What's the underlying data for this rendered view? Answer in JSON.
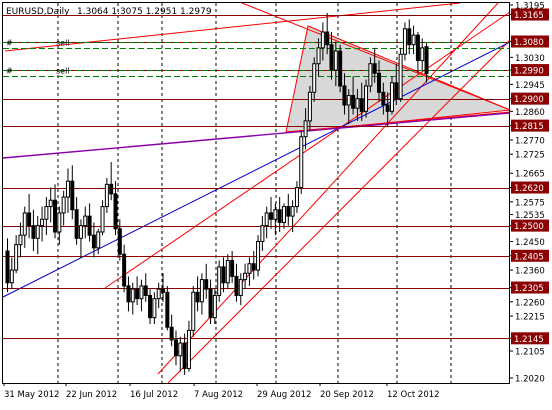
{
  "header": {
    "symbol": "EURUSD,Daily",
    "ohlc": "1.3064 1.3075 1.2951 1.2979"
  },
  "orders": [
    {
      "label": "sell",
      "price": 1.308
    },
    {
      "label": "sell",
      "price": 1.299
    }
  ],
  "colors": {
    "background": "#ffffff",
    "frame": "#000000",
    "candle": "#000000",
    "level_line": "#8b0000",
    "badge": "#8b0000",
    "badge_text": "#ffffff",
    "order_line": "#008000",
    "channel": "#ff0000",
    "trend_blue": "#0000cc",
    "trend_purple": "#8b00a8",
    "triangle_fill": "#d8d8d8",
    "grid": "#000000"
  },
  "chart_data": {
    "type": "candlestick",
    "symbol": "EURUSD",
    "timeframe": "Daily",
    "y_axis": {
      "min": 1.202,
      "max": 1.3195,
      "tick_labels": [
        "1.3195",
        "1.3165",
        "1.3080",
        "1.3030",
        "1.2990",
        "1.2945",
        "1.2900",
        "1.2860",
        "1.2815",
        "1.2770",
        "1.2725",
        "1.2665",
        "1.2620",
        "1.2575",
        "1.2535",
        "1.2500",
        "1.2450",
        "1.2405",
        "1.2360",
        "1.2305",
        "1.2260",
        "1.2215",
        "1.2145",
        "1.2105",
        "1.2020"
      ]
    },
    "x_axis": {
      "tick_labels": [
        "31 May 2012",
        "22 Jun 2012",
        "16 Jul 2012",
        "7 Aug 2012",
        "29 Aug 2012",
        "20 Sep 2012",
        "12 Oct 2012"
      ]
    },
    "levels": [
      1.3165,
      1.308,
      1.299,
      1.29,
      1.2815,
      1.262,
      1.25,
      1.2405,
      1.2305,
      1.2145
    ],
    "grid": "vertical dashed",
    "candles": [
      [
        1.242,
        1.246,
        1.229,
        1.232
      ],
      [
        1.232,
        1.24,
        1.23,
        1.236
      ],
      [
        1.236,
        1.247,
        1.235,
        1.244
      ],
      [
        1.244,
        1.251,
        1.24,
        1.247
      ],
      [
        1.247,
        1.256,
        1.243,
        1.254
      ],
      [
        1.254,
        1.26,
        1.246,
        1.25
      ],
      [
        1.25,
        1.255,
        1.242,
        1.246
      ],
      [
        1.246,
        1.253,
        1.241,
        1.25
      ],
      [
        1.25,
        1.256,
        1.245,
        1.252
      ],
      [
        1.252,
        1.259,
        1.247,
        1.256
      ],
      [
        1.256,
        1.262,
        1.251,
        1.258
      ],
      [
        1.258,
        1.263,
        1.246,
        1.248
      ],
      [
        1.248,
        1.256,
        1.244,
        1.254
      ],
      [
        1.254,
        1.261,
        1.25,
        1.259
      ],
      [
        1.259,
        1.268,
        1.254,
        1.264
      ],
      [
        1.264,
        1.269,
        1.252,
        1.255
      ],
      [
        1.255,
        1.259,
        1.244,
        1.246
      ],
      [
        1.246,
        1.252,
        1.24,
        1.25
      ],
      [
        1.25,
        1.256,
        1.246,
        1.253
      ],
      [
        1.253,
        1.257,
        1.245,
        1.247
      ],
      [
        1.247,
        1.251,
        1.24,
        1.243
      ],
      [
        1.243,
        1.249,
        1.241,
        1.248
      ],
      [
        1.248,
        1.258,
        1.247,
        1.256
      ],
      [
        1.256,
        1.265,
        1.254,
        1.263
      ],
      [
        1.263,
        1.27,
        1.258,
        1.26
      ],
      [
        1.26,
        1.264,
        1.247,
        1.249
      ],
      [
        1.249,
        1.252,
        1.239,
        1.241
      ],
      [
        1.241,
        1.244,
        1.229,
        1.231
      ],
      [
        1.231,
        1.234,
        1.223,
        1.226
      ],
      [
        1.226,
        1.232,
        1.222,
        1.23
      ],
      [
        1.23,
        1.234,
        1.225,
        1.227
      ],
      [
        1.227,
        1.233,
        1.223,
        1.231
      ],
      [
        1.231,
        1.235,
        1.226,
        1.228
      ],
      [
        1.228,
        1.23,
        1.219,
        1.221
      ],
      [
        1.221,
        1.229,
        1.219,
        1.227
      ],
      [
        1.227,
        1.232,
        1.224,
        1.23
      ],
      [
        1.23,
        1.235,
        1.226,
        1.229
      ],
      [
        1.229,
        1.231,
        1.217,
        1.218
      ],
      [
        1.218,
        1.222,
        1.212,
        1.214
      ],
      [
        1.214,
        1.217,
        1.206,
        1.209
      ],
      [
        1.209,
        1.215,
        1.204,
        1.213
      ],
      [
        1.213,
        1.216,
        1.203,
        1.205
      ],
      [
        1.205,
        1.22,
        1.204,
        1.217
      ],
      [
        1.217,
        1.231,
        1.215,
        1.229
      ],
      [
        1.229,
        1.234,
        1.223,
        1.226
      ],
      [
        1.226,
        1.235,
        1.222,
        1.233
      ],
      [
        1.233,
        1.238,
        1.227,
        1.23
      ],
      [
        1.23,
        1.233,
        1.219,
        1.221
      ],
      [
        1.221,
        1.23,
        1.219,
        1.228
      ],
      [
        1.228,
        1.239,
        1.226,
        1.237
      ],
      [
        1.237,
        1.24,
        1.229,
        1.232
      ],
      [
        1.232,
        1.241,
        1.23,
        1.239
      ],
      [
        1.239,
        1.242,
        1.232,
        1.234
      ],
      [
        1.234,
        1.238,
        1.226,
        1.228
      ],
      [
        1.228,
        1.235,
        1.225,
        1.233
      ],
      [
        1.233,
        1.238,
        1.23,
        1.235
      ],
      [
        1.235,
        1.24,
        1.231,
        1.238
      ],
      [
        1.238,
        1.242,
        1.233,
        1.236
      ],
      [
        1.236,
        1.247,
        1.234,
        1.245
      ],
      [
        1.245,
        1.253,
        1.242,
        1.25
      ],
      [
        1.25,
        1.256,
        1.246,
        1.254
      ],
      [
        1.254,
        1.259,
        1.249,
        1.252
      ],
      [
        1.252,
        1.257,
        1.247,
        1.255
      ],
      [
        1.255,
        1.259,
        1.248,
        1.251
      ],
      [
        1.251,
        1.257,
        1.249,
        1.256
      ],
      [
        1.256,
        1.26,
        1.25,
        1.253
      ],
      [
        1.253,
        1.258,
        1.248,
        1.256
      ],
      [
        1.256,
        1.264,
        1.254,
        1.262
      ],
      [
        1.262,
        1.28,
        1.26,
        1.278
      ],
      [
        1.278,
        1.287,
        1.274,
        1.283
      ],
      [
        1.283,
        1.294,
        1.28,
        1.292
      ],
      [
        1.292,
        1.303,
        1.289,
        1.301
      ],
      [
        1.301,
        1.309,
        1.297,
        1.306
      ],
      [
        1.306,
        1.314,
        1.302,
        1.311
      ],
      [
        1.311,
        1.317,
        1.304,
        1.307
      ],
      [
        1.307,
        1.311,
        1.296,
        1.299
      ],
      [
        1.299,
        1.308,
        1.294,
        1.305
      ],
      [
        1.305,
        1.307,
        1.292,
        1.294
      ],
      [
        1.294,
        1.298,
        1.285,
        1.288
      ],
      [
        1.288,
        1.293,
        1.282,
        1.291
      ],
      [
        1.291,
        1.297,
        1.285,
        1.287
      ],
      [
        1.287,
        1.293,
        1.283,
        1.29
      ],
      [
        1.29,
        1.295,
        1.283,
        1.286
      ],
      [
        1.286,
        1.296,
        1.284,
        1.294
      ],
      [
        1.294,
        1.303,
        1.292,
        1.301
      ],
      [
        1.301,
        1.306,
        1.295,
        1.298
      ],
      [
        1.298,
        1.302,
        1.289,
        1.292
      ],
      [
        1.292,
        1.295,
        1.285,
        1.288
      ],
      [
        1.288,
        1.292,
        1.281,
        1.286
      ],
      [
        1.286,
        1.297,
        1.285,
        1.295
      ],
      [
        1.295,
        1.301,
        1.288,
        1.29
      ],
      [
        1.29,
        1.306,
        1.289,
        1.304
      ],
      [
        1.304,
        1.314,
        1.302,
        1.312
      ],
      [
        1.312,
        1.315,
        1.304,
        1.307
      ],
      [
        1.307,
        1.313,
        1.304,
        1.31
      ],
      [
        1.31,
        1.311,
        1.298,
        1.302
      ],
      [
        1.302,
        1.309,
        1.299,
        1.306
      ],
      [
        1.3064,
        1.3075,
        1.2951,
        1.2979
      ]
    ]
  }
}
